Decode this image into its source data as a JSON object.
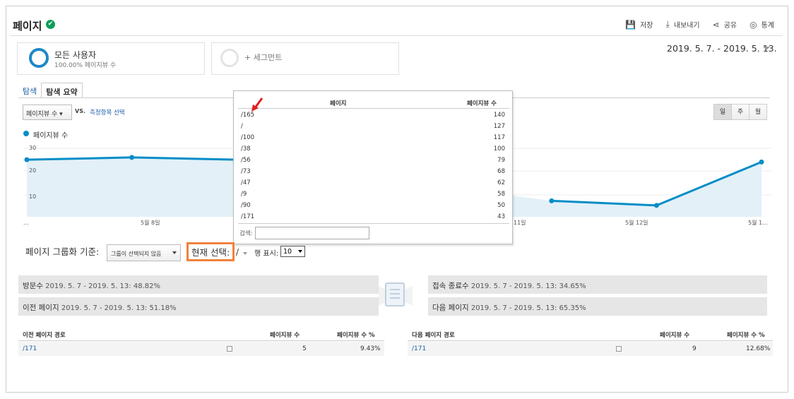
{
  "header": {
    "title": "페이지"
  },
  "toolbar": {
    "save": "저장",
    "export": "내보내기",
    "share": "공유",
    "insights": "통계"
  },
  "segments": [
    {
      "name": "모든 사용자",
      "sub": "100.00% 페이지뷰 수"
    },
    {
      "name": "+ 세그먼트"
    }
  ],
  "date_range": "2019. 5. 7. - 2019. 5. 13.",
  "tabs": [
    "탐색",
    "탐색 요약"
  ],
  "metric_select": "페이지뷰 수",
  "vs_label": "VS.",
  "compare_label": "측정항목 선택",
  "period_buttons": [
    "일",
    "주",
    "월"
  ],
  "legend": {
    "label": "페이지뷰 수",
    "color": "#058dc7"
  },
  "chart_data": {
    "type": "area",
    "series": [
      {
        "name": "페이지뷰 수",
        "values": [
          25,
          26,
          25,
          null,
          null,
          7,
          5,
          24
        ]
      }
    ],
    "y_ticks": [
      "30",
      "20",
      "10"
    ],
    "x_labels": [
      "...",
      "5월 8일",
      "11일",
      "5월 12일",
      "5월 1..."
    ]
  },
  "popup": {
    "col_page": "페이지",
    "col_views": "페이지뷰 수",
    "rows": [
      {
        "page": "/165",
        "views": "140"
      },
      {
        "page": "/",
        "views": "127"
      },
      {
        "page": "/100",
        "views": "117"
      },
      {
        "page": "/38",
        "views": "100"
      },
      {
        "page": "/56",
        "views": "79"
      },
      {
        "page": "/73",
        "views": "68"
      },
      {
        "page": "/47",
        "views": "62"
      },
      {
        "page": "/9",
        "views": "58"
      },
      {
        "page": "/90",
        "views": "50"
      },
      {
        "page": "/171",
        "views": "43"
      }
    ],
    "search_label": "검색:"
  },
  "grouping": {
    "label": "페이지 그룹화 기준:",
    "select": "그룹이 선택되지 않음"
  },
  "current": {
    "label": "현재 선택:",
    "value": "/"
  },
  "rows_show": {
    "label": "행 표시:",
    "value": "10"
  },
  "flow": {
    "entrances": {
      "label": "방문수",
      "value": "2019. 5. 7 - 2019. 5. 13: 48.82%"
    },
    "previous": {
      "label": "이전 페이지",
      "value": "2019. 5. 7 - 2019. 5. 13: 51.18%"
    },
    "exits": {
      "label": "접속 종료수",
      "value": "2019. 5. 7 - 2019. 5. 13: 34.65%"
    },
    "next": {
      "label": "다음 페이지",
      "value": "2019. 5. 7 - 2019. 5. 13: 65.35%"
    }
  },
  "prev_table": {
    "col_path": "이전 페이지 경로",
    "col_views": "페이지뷰 수",
    "col_pct": "페이지뷰 수 %",
    "rows": [
      {
        "path": "/171",
        "views": "5",
        "pct": "9.43%"
      }
    ]
  },
  "next_table": {
    "col_path": "다음 페이지 경로",
    "col_views": "페이지뷰 수",
    "col_pct": "페이지뷰 수 %",
    "rows": [
      {
        "path": "/171",
        "views": "9",
        "pct": "12.68%"
      }
    ]
  },
  "colors": {
    "accent": "#058dc7",
    "highlight": "#f0823c",
    "link": "#1a5ea8",
    "arrow": "#e02020"
  }
}
